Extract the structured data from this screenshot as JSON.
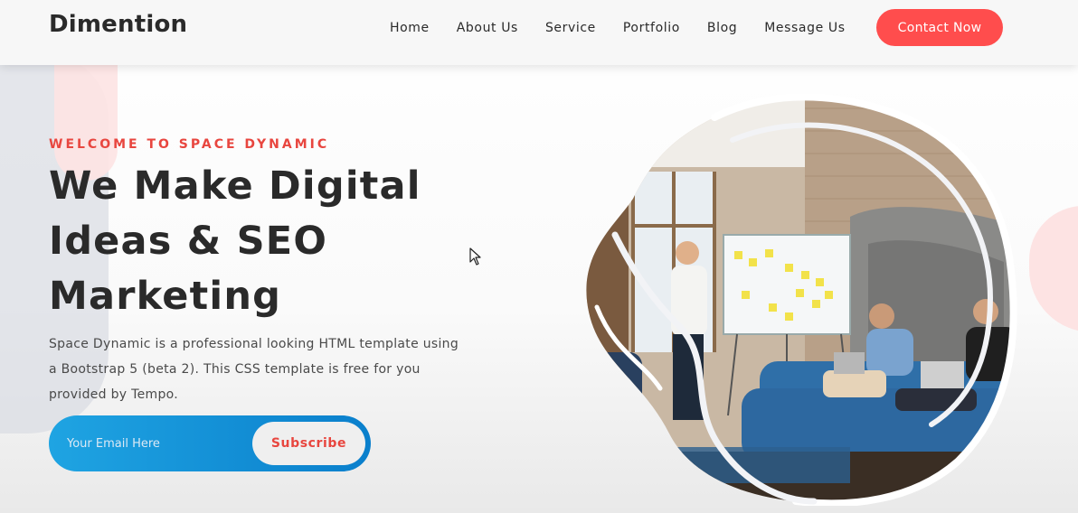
{
  "brand": {
    "logo": "Dimention"
  },
  "nav": {
    "items": [
      {
        "label": "Home"
      },
      {
        "label": "About Us"
      },
      {
        "label": "Service"
      },
      {
        "label": "Portfolio"
      },
      {
        "label": "Blog"
      },
      {
        "label": "Message Us"
      }
    ],
    "cta_label": "Contact Now"
  },
  "hero": {
    "eyebrow": "WELCOME TO SPACE DYNAMIC",
    "title_line1": "We Make Digital",
    "title_line2": "Ideas & SEO",
    "title_line3": "Marketing",
    "description_line1": "Space Dynamic is a professional looking HTML template using",
    "description_line2": "a Bootstrap 5 (beta 2). This CSS template is free for you",
    "description_line3": "provided by Tempo."
  },
  "subscribe": {
    "placeholder": "Your Email Here",
    "button_label": "Subscribe"
  },
  "colors": {
    "accent": "#ff4d4d",
    "eyebrow": "#e8463f",
    "subscribe_gradient_start": "#1fa4e2",
    "subscribe_gradient_end": "#0a7fcc",
    "text_dark": "#2a2a2a"
  },
  "icons": {
    "cursor": "mouse-pointer-icon"
  }
}
